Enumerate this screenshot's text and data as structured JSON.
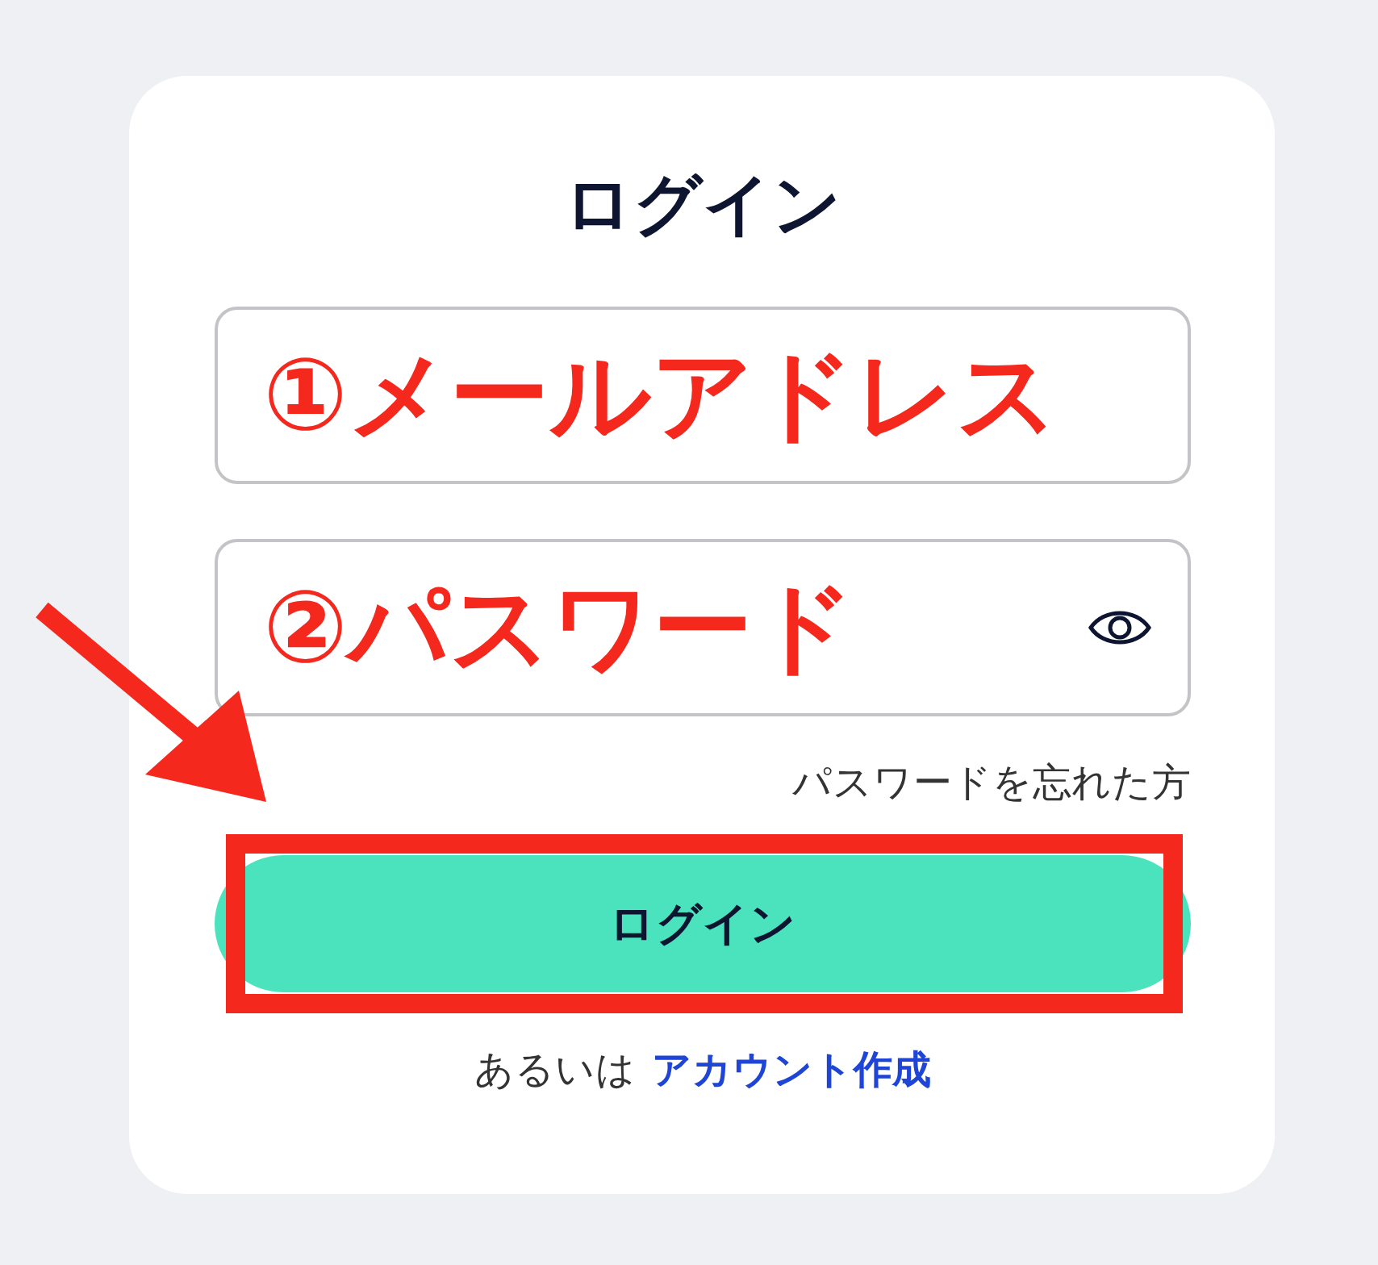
{
  "title": "ログイン",
  "fields": [
    {
      "kind": "email",
      "annotation": "①メールアドレス"
    },
    {
      "kind": "password",
      "annotation": "②パスワード"
    }
  ],
  "forgot_link": "パスワードを忘れた方",
  "login_button": {
    "label": "ログイン",
    "highlighted": true
  },
  "footer": {
    "text": "あるいは",
    "link": "アカウント作成"
  }
}
